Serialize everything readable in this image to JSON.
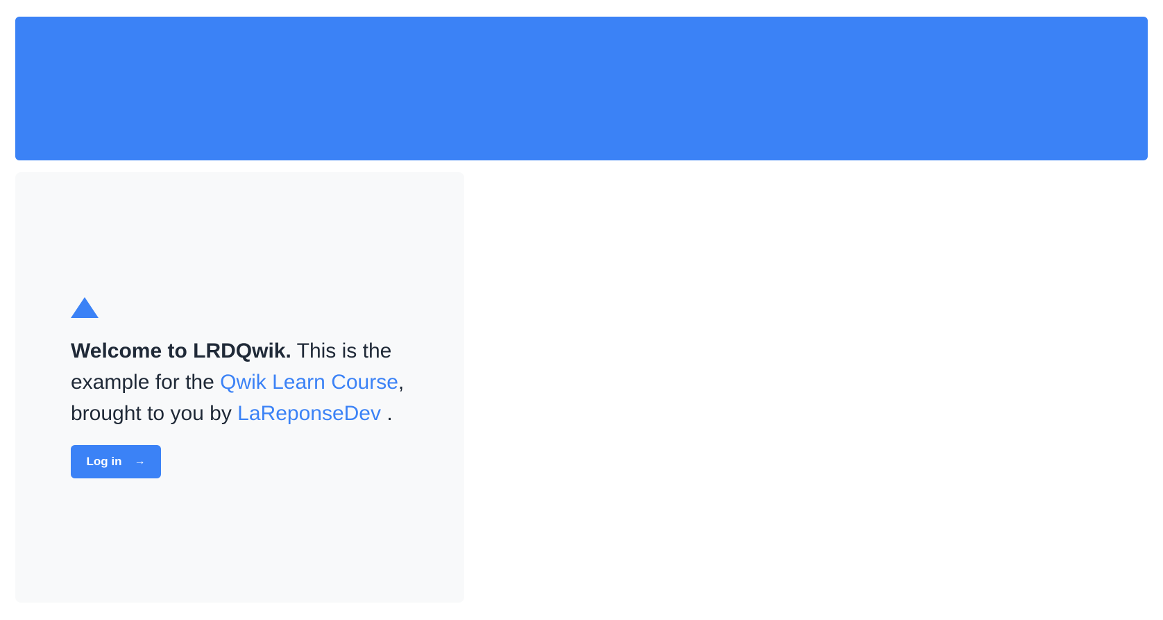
{
  "intro": {
    "brand": "Welcome to LRDQwik.",
    "text_1": " This is the example for the ",
    "course_link": "Qwik Learn Course",
    "text_2": ", brought to you by ",
    "author_link": "LaReponseDev",
    "text_3": " ."
  },
  "login_button": {
    "label": "Log in",
    "arrow": "→"
  },
  "icons": {
    "logo": "triangle-logo-icon",
    "arrow": "arrow-right-icon"
  },
  "colors": {
    "primary": "#3b82f6",
    "panel_background": "#f8f9fa",
    "text": "#1f2937"
  }
}
